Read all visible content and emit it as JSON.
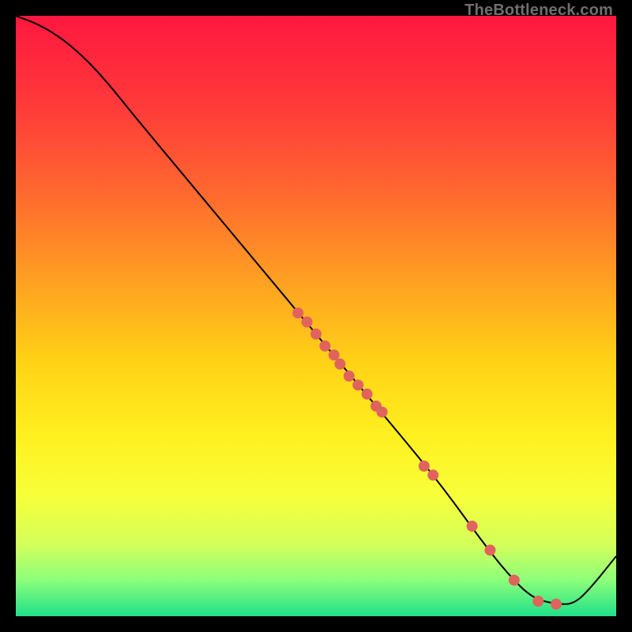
{
  "watermark": "TheBottleneck.com",
  "chart_data": {
    "type": "line",
    "title": "",
    "xlabel": "",
    "ylabel": "",
    "xlim": [
      0,
      100
    ],
    "ylim": [
      0,
      100
    ],
    "grid": false,
    "legend": false,
    "background_gradient": {
      "stops": [
        {
          "offset": 0.0,
          "color": "#ff173f"
        },
        {
          "offset": 0.15,
          "color": "#ff3a3a"
        },
        {
          "offset": 0.3,
          "color": "#ff6a2f"
        },
        {
          "offset": 0.45,
          "color": "#ffa321"
        },
        {
          "offset": 0.58,
          "color": "#ffd316"
        },
        {
          "offset": 0.7,
          "color": "#fff020"
        },
        {
          "offset": 0.8,
          "color": "#f7ff3a"
        },
        {
          "offset": 0.88,
          "color": "#d4ff5a"
        },
        {
          "offset": 0.94,
          "color": "#8cff7a"
        },
        {
          "offset": 1.0,
          "color": "#1fe08a"
        }
      ]
    },
    "line": {
      "color": "#000000",
      "width": 2,
      "points": [
        {
          "x": 0.0,
          "y": 100.0
        },
        {
          "x": 4.0,
          "y": 98.5
        },
        {
          "x": 8.0,
          "y": 96.0
        },
        {
          "x": 12.0,
          "y": 92.5
        },
        {
          "x": 16.0,
          "y": 88.0
        },
        {
          "x": 20.0,
          "y": 83.0
        },
        {
          "x": 30.0,
          "y": 71.0
        },
        {
          "x": 40.0,
          "y": 59.0
        },
        {
          "x": 50.0,
          "y": 47.0
        },
        {
          "x": 60.0,
          "y": 35.0
        },
        {
          "x": 70.0,
          "y": 23.0
        },
        {
          "x": 78.0,
          "y": 12.0
        },
        {
          "x": 82.0,
          "y": 7.0
        },
        {
          "x": 86.0,
          "y": 3.0
        },
        {
          "x": 90.0,
          "y": 2.0
        },
        {
          "x": 93.0,
          "y": 2.0
        },
        {
          "x": 96.0,
          "y": 5.0
        },
        {
          "x": 100.0,
          "y": 10.0
        }
      ]
    },
    "scatter": {
      "color": "#e0635d",
      "radius": 7,
      "points": [
        {
          "x": 47.0,
          "y": 50.5
        },
        {
          "x": 48.5,
          "y": 49.0
        },
        {
          "x": 50.0,
          "y": 47.0
        },
        {
          "x": 51.5,
          "y": 45.0
        },
        {
          "x": 53.0,
          "y": 43.5
        },
        {
          "x": 54.0,
          "y": 42.0
        },
        {
          "x": 55.5,
          "y": 40.0
        },
        {
          "x": 57.0,
          "y": 38.5
        },
        {
          "x": 58.5,
          "y": 37.0
        },
        {
          "x": 60.0,
          "y": 35.0
        },
        {
          "x": 61.0,
          "y": 34.0
        },
        {
          "x": 68.0,
          "y": 25.0
        },
        {
          "x": 69.5,
          "y": 23.5
        },
        {
          "x": 76.0,
          "y": 15.0
        },
        {
          "x": 79.0,
          "y": 11.0
        },
        {
          "x": 83.0,
          "y": 6.0
        },
        {
          "x": 87.0,
          "y": 2.5
        },
        {
          "x": 90.0,
          "y": 2.0
        }
      ]
    }
  }
}
